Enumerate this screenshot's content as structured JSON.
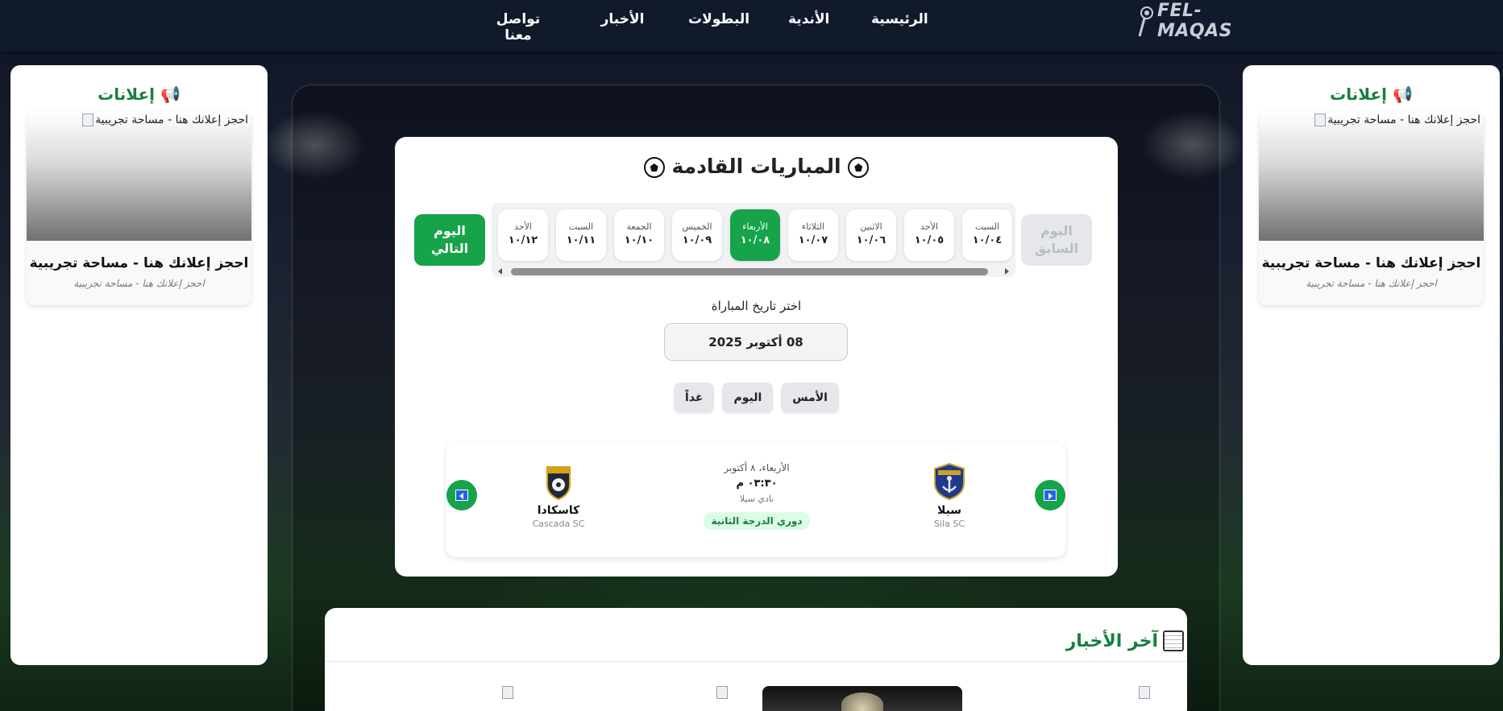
{
  "nav": {
    "logo_text": "FEL-MAQAS",
    "links": [
      "الرئيسية",
      "الأندية",
      "البطولات",
      "الأخبار",
      "تواصل معنا"
    ]
  },
  "ads": {
    "title": "إعلانات",
    "image_alt": "احجز إعلانك هنا - مساحة تجريبية",
    "card_title": "احجز إعلانك هنا - مساحة تجريبية",
    "card_sub": "احجز إعلانك هنا - مساحة تجريبية"
  },
  "matches": {
    "title": "المباريات القادمة",
    "prev_day": "اليوم السابق",
    "next_day": "اليوم التالي",
    "days": [
      {
        "name": "السبت",
        "date": "١٠/٠٤"
      },
      {
        "name": "الأحد",
        "date": "١٠/٠٥"
      },
      {
        "name": "الاثنين",
        "date": "١٠/٠٦"
      },
      {
        "name": "الثلاثاء",
        "date": "١٠/٠٧"
      },
      {
        "name": "الأربعاء",
        "date": "١٠/٠٨",
        "active": true
      },
      {
        "name": "الخميس",
        "date": "١٠/٠٩"
      },
      {
        "name": "الجمعة",
        "date": "١٠/١٠"
      },
      {
        "name": "السبت",
        "date": "١٠/١١"
      },
      {
        "name": "الأحد",
        "date": "١٠/١٢"
      }
    ],
    "pick_label": "اختر تاريخ المباراة",
    "date_value": "08 أكتوبر 2025",
    "quick": {
      "yesterday": "الأمس",
      "today": "اليوم",
      "tomorrow": "غداً"
    },
    "match": {
      "home_name": "سيلا",
      "home_en": "Sila SC",
      "away_name": "كاسكادا",
      "away_en": "Cascada SC",
      "date": "الأربعاء، ٨ أكتوبر",
      "time": "٠٣:٣٠ م",
      "venue": "نادي سيلا",
      "league": "دوري الدرجة الثانية"
    }
  },
  "news": {
    "title": "آخر الأخبار"
  },
  "colors": {
    "accent_green": "#16a34a",
    "nav_bg": "#111a2b"
  }
}
